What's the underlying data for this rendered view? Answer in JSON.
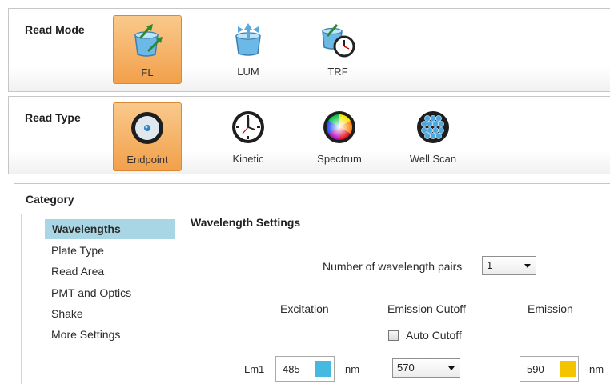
{
  "read_mode": {
    "title": "Read Mode",
    "options": [
      {
        "label": "FL",
        "icon": "fl-mode-icon",
        "selected": true
      },
      {
        "label": "LUM",
        "icon": "lum-mode-icon",
        "selected": false
      },
      {
        "label": "TRF",
        "icon": "trf-mode-icon",
        "selected": false
      }
    ]
  },
  "read_type": {
    "title": "Read Type",
    "options": [
      {
        "label": "Endpoint",
        "icon": "endpoint-icon",
        "selected": true
      },
      {
        "label": "Kinetic",
        "icon": "clock-icon",
        "selected": false
      },
      {
        "label": "Spectrum",
        "icon": "color-wheel-icon",
        "selected": false
      },
      {
        "label": "Well Scan",
        "icon": "well-plate-icon",
        "selected": false
      }
    ]
  },
  "category": {
    "title": "Category",
    "items": [
      {
        "label": "Wavelengths",
        "selected": true
      },
      {
        "label": "Plate Type",
        "selected": false
      },
      {
        "label": "Read Area",
        "selected": false
      },
      {
        "label": "PMT and Optics",
        "selected": false
      },
      {
        "label": "Shake",
        "selected": false
      },
      {
        "label": "More Settings",
        "selected": false
      }
    ]
  },
  "wavelength_settings": {
    "title": "Wavelength Settings",
    "pairs_label": "Number of wavelength pairs",
    "pairs_value": "1",
    "columns": {
      "excitation": "Excitation",
      "emission_cutoff": "Emission Cutoff",
      "emission": "Emission"
    },
    "auto_cutoff_label": "Auto Cutoff",
    "auto_cutoff_checked": false,
    "row": {
      "label": "Lm1",
      "excitation": "485",
      "excitation_color": "#45b9e0",
      "excitation_unit": "nm",
      "cutoff": "570",
      "emission": "590",
      "emission_color": "#f5c400",
      "emission_unit": "nm"
    }
  },
  "colors": {
    "selected_tile": "#f4a650",
    "selected_category": "#a9d6e5"
  }
}
